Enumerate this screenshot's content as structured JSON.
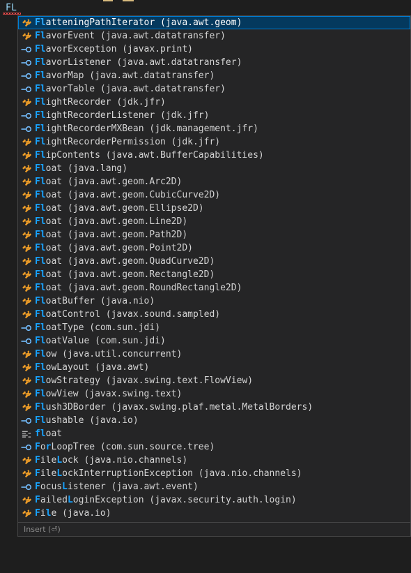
{
  "editor": {
    "typed_text": "FL"
  },
  "suggestions": [
    {
      "match": "Fl",
      "rest": "atteningPathIterator (java.awt.geom)",
      "kind": "class",
      "selected": true
    },
    {
      "match": "Fl",
      "rest": "avorEvent (java.awt.datatransfer)",
      "kind": "class"
    },
    {
      "match": "Fl",
      "rest": "avorException (javax.print)",
      "kind": "interface"
    },
    {
      "match": "Fl",
      "rest": "avorListener (java.awt.datatransfer)",
      "kind": "interface"
    },
    {
      "match": "Fl",
      "rest": "avorMap (java.awt.datatransfer)",
      "kind": "interface"
    },
    {
      "match": "Fl",
      "rest": "avorTable (java.awt.datatransfer)",
      "kind": "interface"
    },
    {
      "match": "Fl",
      "rest": "ightRecorder (jdk.jfr)",
      "kind": "class"
    },
    {
      "match": "Fl",
      "rest": "ightRecorderListener (jdk.jfr)",
      "kind": "interface"
    },
    {
      "match": "Fl",
      "rest": "ightRecorderMXBean (jdk.management.jfr)",
      "kind": "interface"
    },
    {
      "match": "Fl",
      "rest": "ightRecorderPermission (jdk.jfr)",
      "kind": "class"
    },
    {
      "match": "Fl",
      "rest": "ipContents (java.awt.BufferCapabilities)",
      "kind": "class"
    },
    {
      "match": "Fl",
      "rest": "oat (java.lang)",
      "kind": "class"
    },
    {
      "match": "Fl",
      "rest": "oat (java.awt.geom.Arc2D)",
      "kind": "class"
    },
    {
      "match": "Fl",
      "rest": "oat (java.awt.geom.CubicCurve2D)",
      "kind": "class"
    },
    {
      "match": "Fl",
      "rest": "oat (java.awt.geom.Ellipse2D)",
      "kind": "class"
    },
    {
      "match": "Fl",
      "rest": "oat (java.awt.geom.Line2D)",
      "kind": "class"
    },
    {
      "match": "Fl",
      "rest": "oat (java.awt.geom.Path2D)",
      "kind": "class"
    },
    {
      "match": "Fl",
      "rest": "oat (java.awt.geom.Point2D)",
      "kind": "class"
    },
    {
      "match": "Fl",
      "rest": "oat (java.awt.geom.QuadCurve2D)",
      "kind": "class"
    },
    {
      "match": "Fl",
      "rest": "oat (java.awt.geom.Rectangle2D)",
      "kind": "class"
    },
    {
      "match": "Fl",
      "rest": "oat (java.awt.geom.RoundRectangle2D)",
      "kind": "class"
    },
    {
      "match": "Fl",
      "rest": "oatBuffer (java.nio)",
      "kind": "class"
    },
    {
      "match": "Fl",
      "rest": "oatControl (javax.sound.sampled)",
      "kind": "class"
    },
    {
      "match": "Fl",
      "rest": "oatType (com.sun.jdi)",
      "kind": "interface"
    },
    {
      "match": "Fl",
      "rest": "oatValue (com.sun.jdi)",
      "kind": "interface"
    },
    {
      "match": "Fl",
      "rest": "ow (java.util.concurrent)",
      "kind": "class"
    },
    {
      "match": "Fl",
      "rest": "owLayout (java.awt)",
      "kind": "class"
    },
    {
      "match": "Fl",
      "rest": "owStrategy (javax.swing.text.FlowView)",
      "kind": "class"
    },
    {
      "match": "Fl",
      "rest": "owView (javax.swing.text)",
      "kind": "class"
    },
    {
      "match": "Fl",
      "rest": "ush3DBorder (javax.swing.plaf.metal.MetalBorders)",
      "kind": "class"
    },
    {
      "match": "Fl",
      "rest": "ushable (java.io)",
      "kind": "interface"
    },
    {
      "match": "fl",
      "rest": "oat",
      "kind": "keyword"
    },
    {
      "parts": [
        "F",
        "o",
        "r",
        "L",
        "oopTree (com.sun.source.tree)"
      ],
      "kind": "interface"
    },
    {
      "parts": [
        "F",
        "ile",
        "L",
        "ock (java.nio.channels)"
      ],
      "kind": "class"
    },
    {
      "parts": [
        "F",
        "ile",
        "L",
        "ockInterruptionException (java.nio.channels)"
      ],
      "kind": "class"
    },
    {
      "parts": [
        "F",
        "ocus",
        "L",
        "istener (java.awt.event)"
      ],
      "kind": "interface"
    },
    {
      "parts": [
        "F",
        "ailed",
        "L",
        "oginException (javax.security.auth.login)"
      ],
      "kind": "class"
    },
    {
      "parts": [
        "F",
        "i",
        "l",
        "e (java.io)"
      ],
      "kind": "class"
    }
  ],
  "footer": {
    "text": "Insert (⏎)"
  },
  "colors": {
    "match": "#18a3ff",
    "class_icon": "#ee9d28",
    "interface_icon": "#75beff",
    "keyword_icon": "#c5c5c5",
    "selection": "#04395e"
  }
}
